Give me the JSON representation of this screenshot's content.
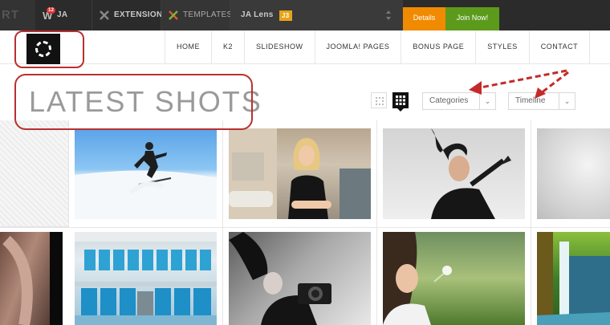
{
  "topbar": {
    "brand_fragment": "RT",
    "items": [
      {
        "label": "JA WALL",
        "badge": "12"
      },
      {
        "label": "EXTENSIONS"
      },
      {
        "label": "TEMPLATES"
      }
    ],
    "product": {
      "name": "JA Lens",
      "version": "J3"
    },
    "details_label": "Details",
    "join_label": "Join Now!"
  },
  "nav": {
    "items": [
      "HOME",
      "K2",
      "SLIDESHOW",
      "JOOMLA! PAGES",
      "BONUS PAGE",
      "STYLES",
      "CONTACT"
    ]
  },
  "page": {
    "title": "LATEST SHOTS"
  },
  "filters": {
    "categories": {
      "placeholder": "Categories"
    },
    "timeline": {
      "placeholder": "Timeline"
    }
  },
  "colors": {
    "topbar_bg": "#2b2b2b",
    "details_bg": "#f08a00",
    "join_bg": "#5c9a1c",
    "version_badge": "#e8a317",
    "annotation": "#b83030",
    "title_text": "#9a9a9a"
  },
  "icons": {
    "view_list": "grid-small-icon",
    "view_grid": "grid-large-icon",
    "dropdown": "chevron-down-icon"
  }
}
